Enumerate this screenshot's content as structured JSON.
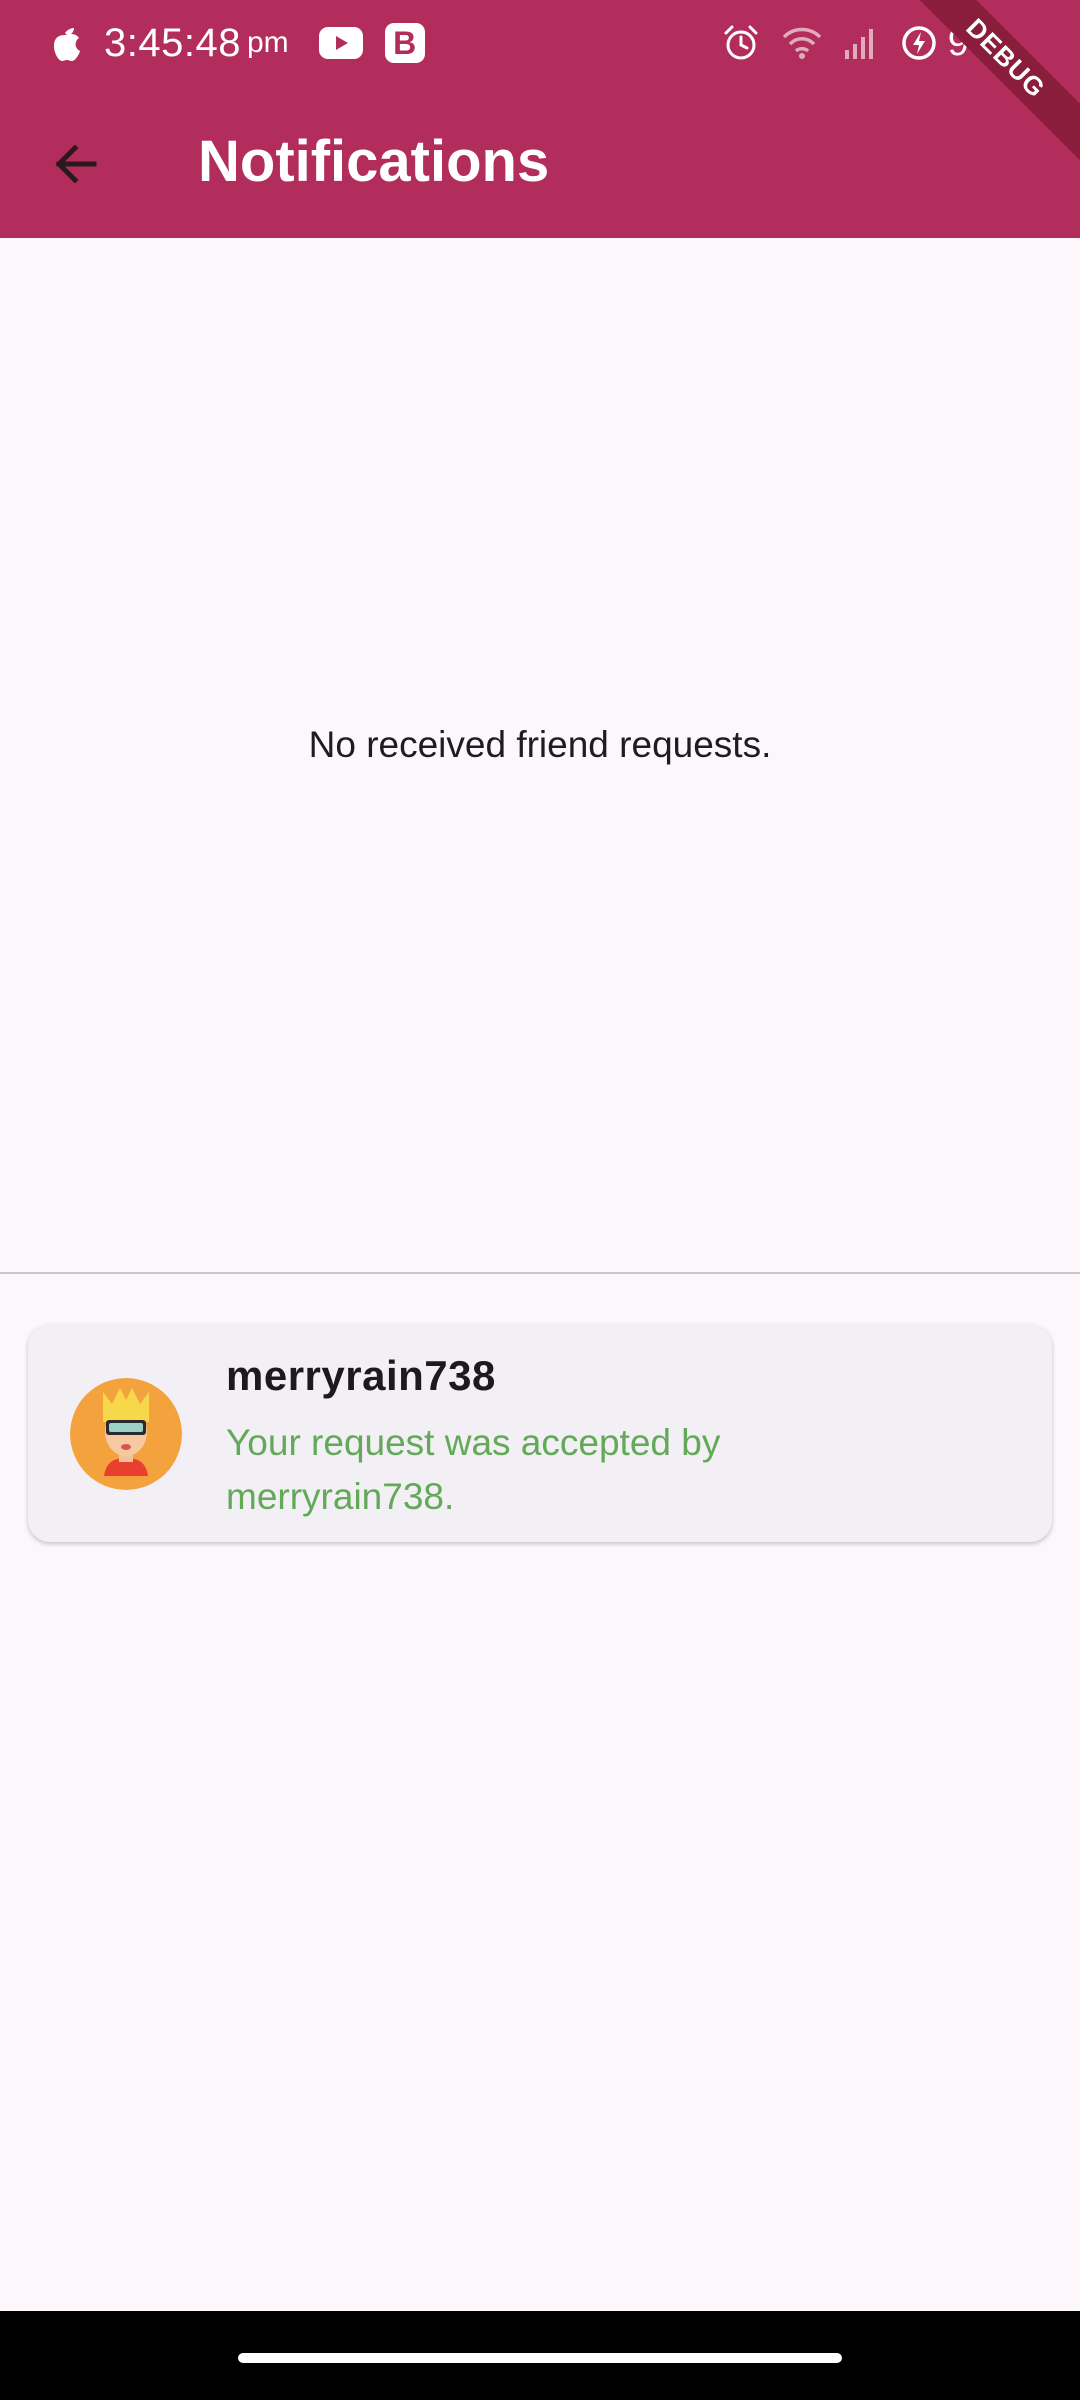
{
  "status_bar": {
    "time": "3:45:48",
    "time_suffix": "pm",
    "b_icon_letter": "B",
    "battery": "96"
  },
  "debug_banner": "DEBUG",
  "header": {
    "title": "Notifications",
    "background": "#b22d5b"
  },
  "main": {
    "empty_message": "No received friend requests."
  },
  "notifications": [
    {
      "username": "merryrain738",
      "message": "Your request was accepted by merryrain738.",
      "message_color": "#62a958",
      "avatar_icon": "avatar-icon"
    }
  ]
}
